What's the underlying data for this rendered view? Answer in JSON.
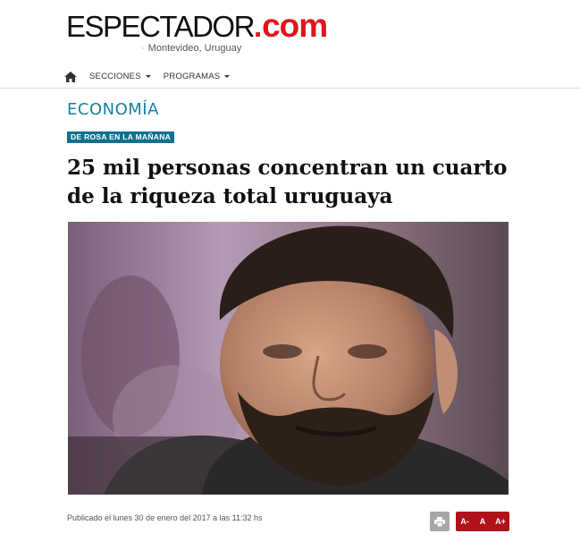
{
  "header": {
    "logo_main": "ESPECTADOR",
    "logo_dot": ".",
    "logo_com": "com",
    "location_sep": "·",
    "location": "Montevideo, Uruguay"
  },
  "nav": {
    "home_icon": "home-icon",
    "items": [
      {
        "label": "SECCIONES"
      },
      {
        "label": "PROGRAMAS"
      }
    ]
  },
  "article": {
    "section": "ECONOMÍA",
    "program_badge": "DE ROSA EN LA MAÑANA",
    "headline": "25 mil personas concentran un cuarto de la riqueza total uruguaya",
    "published": "Publicado el lunes 30 de enero del 2017 a las 11:32 hs"
  },
  "tools": {
    "print_icon": "print-icon",
    "font_decrease": "A-",
    "font_normal": "A",
    "font_increase": "A+"
  },
  "colors": {
    "brand_red": "#e0151b",
    "section_blue": "#1a7fa0",
    "badge_bg": "#11718f",
    "font_controls_bg": "#b1121a"
  }
}
